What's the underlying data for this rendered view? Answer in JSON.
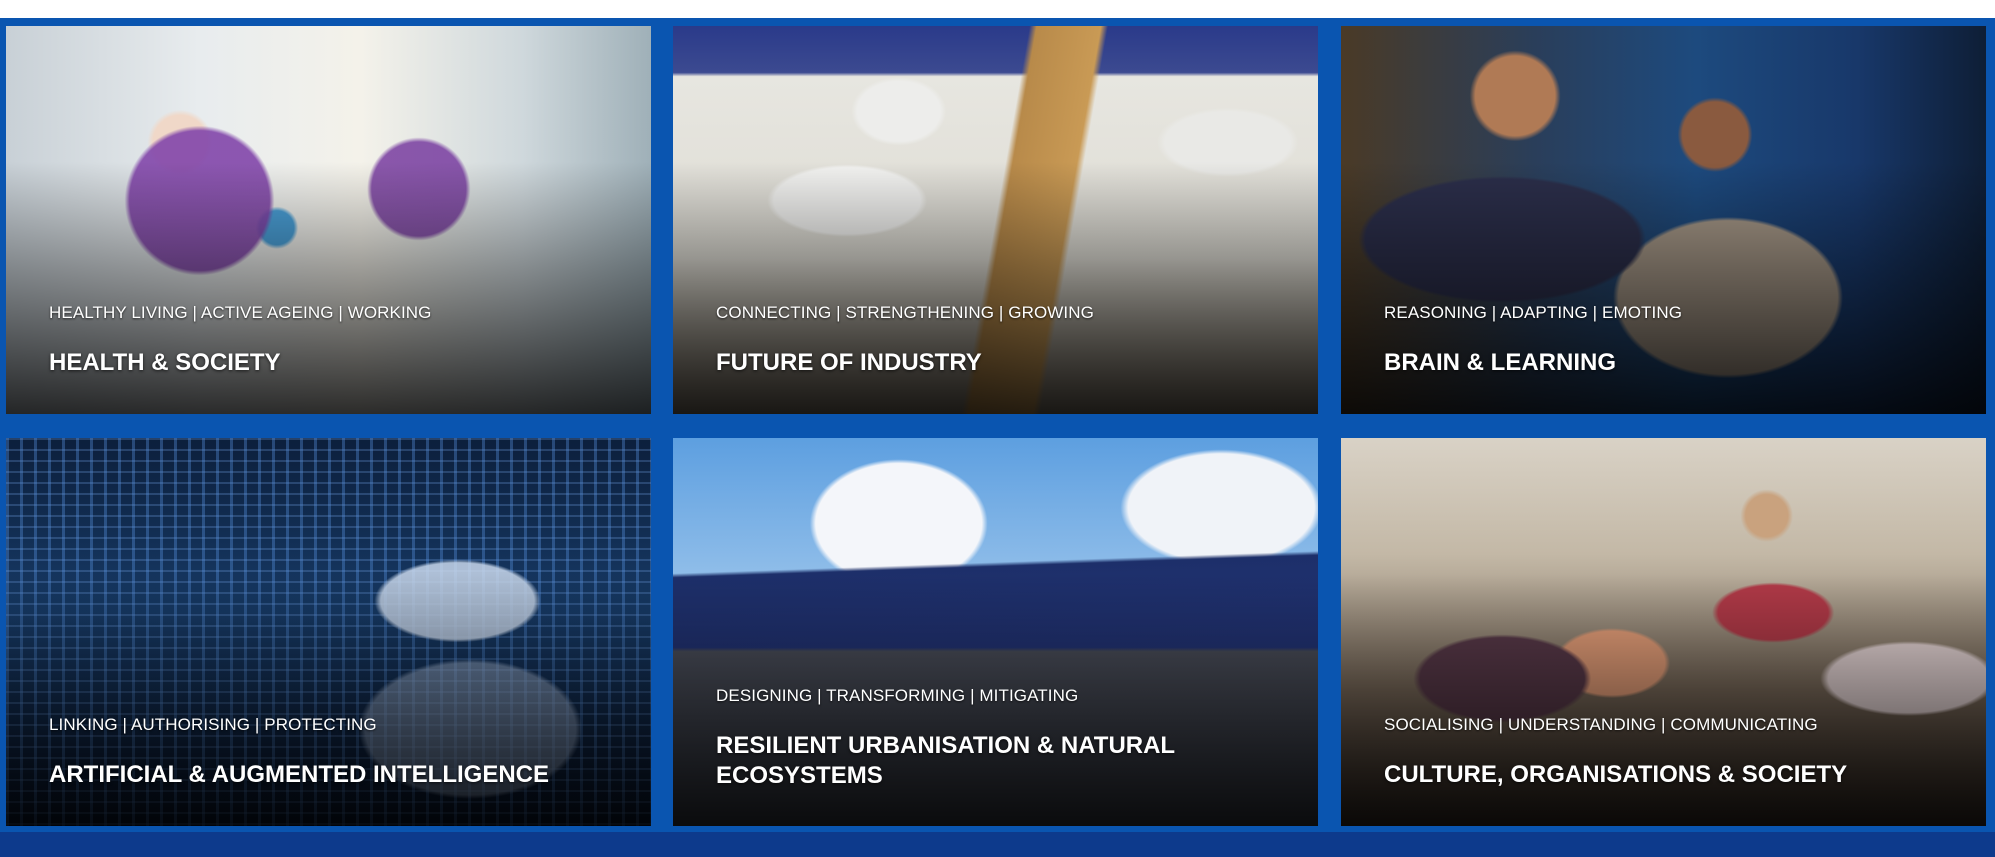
{
  "colors": {
    "grid_background": "#0a55b0",
    "footer_bar": "#0d3a8c",
    "text": "#ffffff"
  },
  "tiles": [
    {
      "tags": "HEALTHY LIVING | ACTIVE AGEING | WORKING",
      "title": "HEALTH & SOCIETY"
    },
    {
      "tags": "CONNECTING | STRENGTHENING | GROWING",
      "title": "FUTURE OF INDUSTRY"
    },
    {
      "tags": "REASONING | ADAPTING | EMOTING",
      "title": "BRAIN & LEARNING"
    },
    {
      "tags": "LINKING | AUTHORISING | PROTECTING",
      "title": "ARTIFICIAL & AUGMENTED INTELLIGENCE"
    },
    {
      "tags": "DESIGNING | TRANSFORMING | MITIGATING",
      "title": "RESILIENT URBANISATION & NATURAL ECOSYSTEMS"
    },
    {
      "tags": "SOCIALISING | UNDERSTANDING | COMMUNICATING",
      "title": "CULTURE, ORGANISATIONS & SOCIETY"
    }
  ]
}
